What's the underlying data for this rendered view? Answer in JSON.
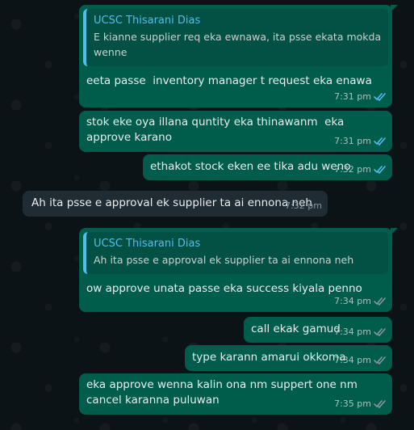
{
  "messages": [
    {
      "reply_to": {
        "author": "UCSC Thisarani Dias",
        "text": "E kianne supplier req eka ewnawa, ita psse ekata mokda wenne"
      },
      "text": "eeta passe  inventory manager t request eka enawa",
      "time": "7:31 pm"
    },
    {
      "text": "stok eke oya illana quntity eka thinawanm  eka approve karano",
      "time": "7:31 pm"
    },
    {
      "text": "ethakot stock eken ee tika adu weno",
      "time": "7:32 pm"
    },
    {
      "text": "Ah ita psse e approval ek supplier ta ai ennona neh",
      "time": "7:32 pm"
    },
    {
      "reply_to": {
        "author": "UCSC Thisarani Dias",
        "text": "Ah ita psse e approval ek supplier ta ai ennona neh"
      },
      "text": "ow approve unata passe eka success kiyala penno",
      "time": "7:34 pm"
    },
    {
      "text": "call ekak gamud",
      "time": "7:34 pm"
    },
    {
      "text": "type karann amarui okkoma",
      "time": "7:34 pm"
    },
    {
      "text": "eka approve wenna kalin ona nm suppert one nm cancel karanna puluwan",
      "time": "7:35 pm"
    }
  ],
  "colors": {
    "outgoing": "#005c4b",
    "incoming": "#202c33",
    "quote_accent": "#53bdeb",
    "read_ticks": "#53bdeb",
    "sent_ticks": "#8696a0"
  },
  "icons": {
    "read": "double-check-icon"
  }
}
